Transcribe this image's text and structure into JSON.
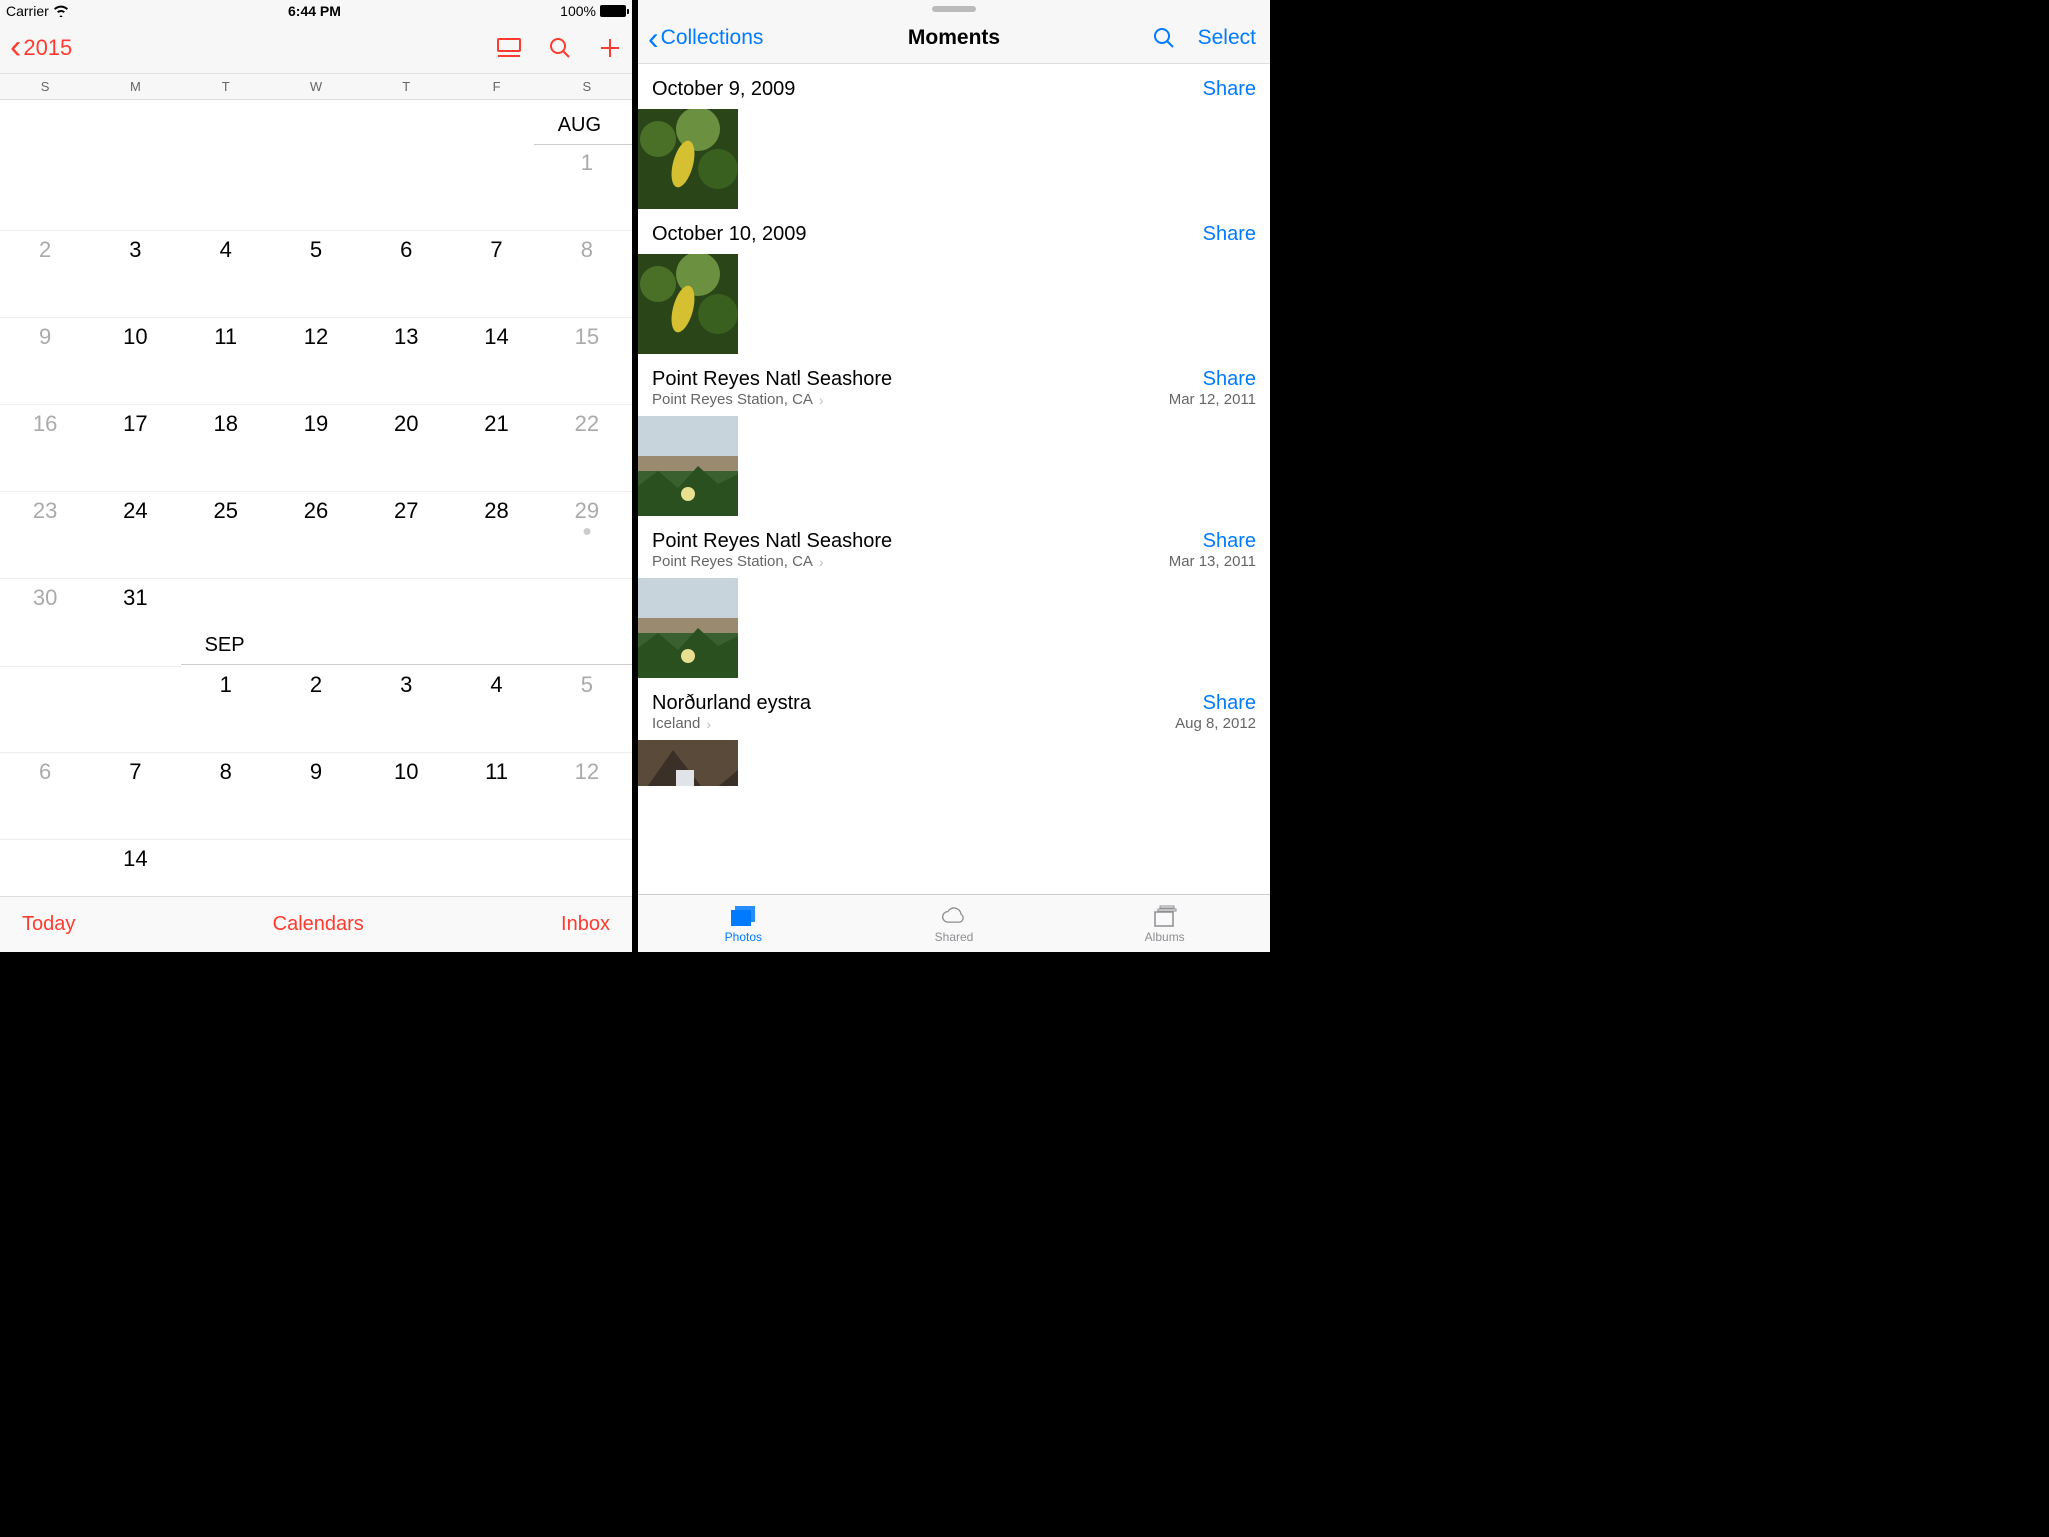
{
  "status": {
    "carrier": "Carrier",
    "time": "6:44 PM",
    "battery_pct": "100%"
  },
  "calendar": {
    "back_year": "2015",
    "weekdays": [
      "S",
      "M",
      "T",
      "W",
      "T",
      "F",
      "S"
    ],
    "months": {
      "aug": {
        "label": "AUG"
      },
      "sep": {
        "label": "SEP"
      }
    },
    "grid": [
      {
        "cells": [
          "",
          "",
          "",
          "",
          "",
          "",
          "1"
        ],
        "weekend_mask": [
          1,
          0,
          0,
          0,
          0,
          0,
          1
        ],
        "has_line_before_col": 6
      },
      {
        "cells": [
          "2",
          "3",
          "4",
          "5",
          "6",
          "7",
          "8"
        ],
        "weekend_mask": [
          1,
          0,
          0,
          0,
          0,
          0,
          1
        ]
      },
      {
        "cells": [
          "9",
          "10",
          "11",
          "12",
          "13",
          "14",
          "15"
        ],
        "weekend_mask": [
          1,
          0,
          0,
          0,
          0,
          0,
          1
        ]
      },
      {
        "cells": [
          "16",
          "17",
          "18",
          "19",
          "20",
          "21",
          "22"
        ],
        "weekend_mask": [
          1,
          0,
          0,
          0,
          0,
          0,
          1
        ]
      },
      {
        "cells": [
          "23",
          "24",
          "25",
          "26",
          "27",
          "28",
          "29"
        ],
        "weekend_mask": [
          1,
          0,
          0,
          0,
          0,
          0,
          1
        ],
        "dot_col": 6
      },
      {
        "cells": [
          "30",
          "31",
          "",
          "",
          "",
          "",
          ""
        ],
        "weekend_mask": [
          1,
          0,
          0,
          0,
          0,
          0,
          1
        ],
        "line_end_col": 2
      },
      {
        "cells": [
          "",
          "",
          "1",
          "2",
          "3",
          "4",
          "5"
        ],
        "weekend_mask": [
          1,
          0,
          0,
          0,
          0,
          0,
          1
        ],
        "has_line_before_col": 2,
        "sep_label": true
      },
      {
        "cells": [
          "6",
          "7",
          "8",
          "9",
          "10",
          "11",
          "12"
        ],
        "weekend_mask": [
          1,
          0,
          0,
          0,
          0,
          0,
          1
        ]
      },
      {
        "cells": [
          "",
          "14",
          "",
          "",
          "",
          "",
          ""
        ],
        "weekend_mask": [
          1,
          0,
          0,
          0,
          0,
          0,
          1
        ],
        "partial": true
      }
    ],
    "toolbar": {
      "today": "Today",
      "calendars": "Calendars",
      "inbox": "Inbox"
    }
  },
  "photos": {
    "back_label": "Collections",
    "title": "Moments",
    "select": "Select",
    "moments": [
      {
        "title": "October 9, 2009",
        "subtitle": "",
        "date": "",
        "share": "Share",
        "thumbs": 1,
        "thumb_style": "leaf"
      },
      {
        "title": "October 10, 2009",
        "subtitle": "",
        "date": "",
        "share": "Share",
        "thumbs": 1,
        "thumb_style": "leaf"
      },
      {
        "title": "Point Reyes Natl Seashore",
        "subtitle": "Point Reyes Station, CA",
        "date": "Mar 12, 2011",
        "share": "Share",
        "thumbs": 1,
        "thumb_style": "coast"
      },
      {
        "title": "Point Reyes Natl Seashore",
        "subtitle": "Point Reyes Station, CA",
        "date": "Mar 13, 2011",
        "share": "Share",
        "thumbs": 1,
        "thumb_style": "coast"
      },
      {
        "title": "Norðurland eystra",
        "subtitle": "Iceland",
        "date": "Aug 8, 2012",
        "share": "Share",
        "thumbs": 1,
        "thumb_style": "iceland"
      }
    ],
    "tabs": {
      "photos": "Photos",
      "shared": "Shared",
      "albums": "Albums"
    }
  }
}
